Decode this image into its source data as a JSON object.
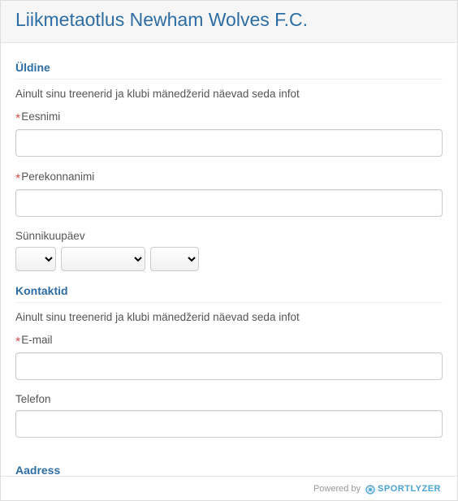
{
  "header": {
    "title": "Liikmetaotlus Newham Wolves F.C."
  },
  "sections": {
    "general": {
      "title": "Üldine",
      "privacy": "Ainult sinu treenerid ja klubi mänedžerid näevad seda infot",
      "firstNameLabel": "Eesnimi",
      "lastNameLabel": "Perekonnanimi",
      "dobLabel": "Sünnikuupäev"
    },
    "contacts": {
      "title": "Kontaktid",
      "privacy": "Ainult sinu treenerid ja klubi mänedžerid näevad seda infot",
      "emailLabel": "E-mail",
      "phoneLabel": "Telefon"
    },
    "address": {
      "title": "Aadress"
    }
  },
  "footer": {
    "poweredBy": "Powered by",
    "brand": "SPORTLYZER"
  }
}
